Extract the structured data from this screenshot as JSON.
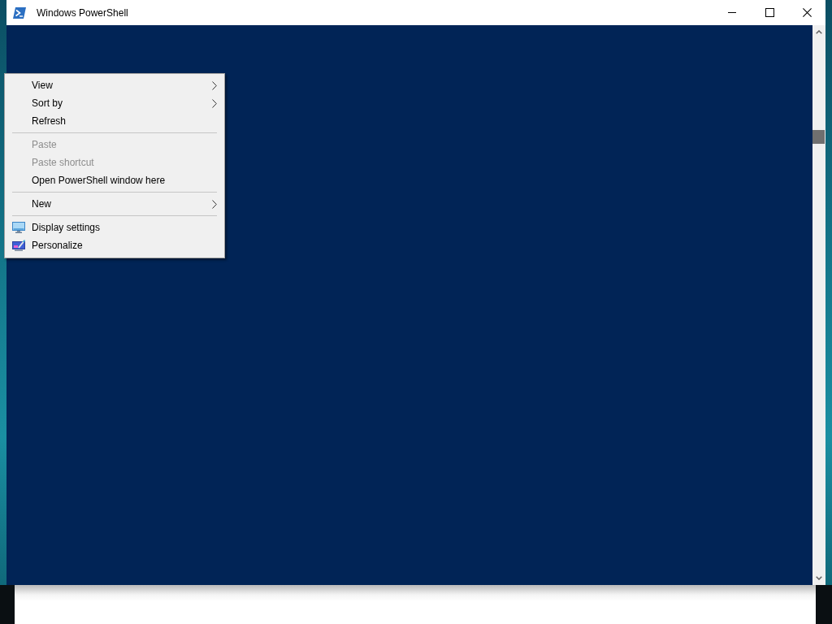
{
  "window": {
    "title": "Windows PowerShell"
  },
  "context_menu": {
    "groups": [
      {
        "items": [
          {
            "label": "View",
            "disabled": false,
            "submenu": true
          },
          {
            "label": "Sort by",
            "disabled": false,
            "submenu": true
          },
          {
            "label": "Refresh",
            "disabled": false,
            "submenu": false
          }
        ]
      },
      {
        "items": [
          {
            "label": "Paste",
            "disabled": true,
            "submenu": false
          },
          {
            "label": "Paste shortcut",
            "disabled": true,
            "submenu": false
          },
          {
            "label": "Open PowerShell window here",
            "disabled": false,
            "submenu": false
          }
        ]
      },
      {
        "items": [
          {
            "label": "New",
            "disabled": false,
            "submenu": true
          }
        ]
      },
      {
        "items": [
          {
            "label": "Display settings",
            "disabled": false,
            "submenu": false
          },
          {
            "label": "Personalize",
            "disabled": false,
            "submenu": false
          }
        ]
      }
    ]
  }
}
